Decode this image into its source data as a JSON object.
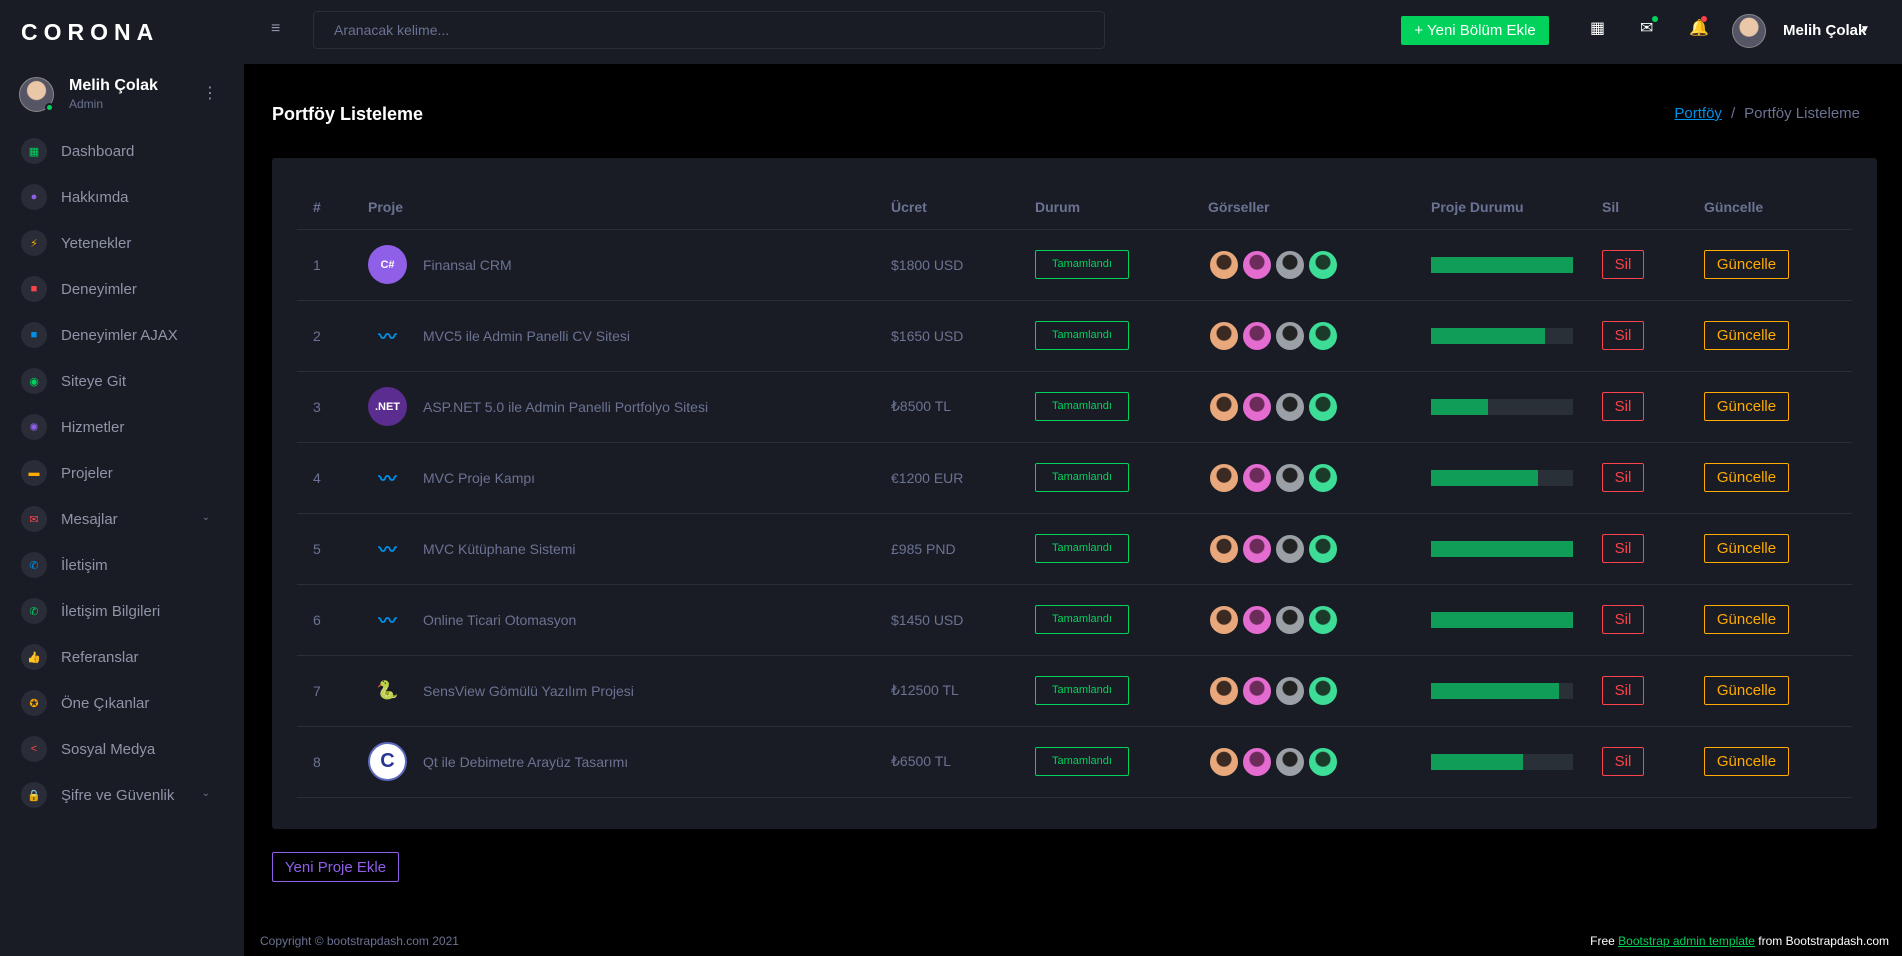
{
  "brand": "CORONA",
  "profile": {
    "name": "Melih Çolak",
    "role": "Admin"
  },
  "sidebar": {
    "items": [
      {
        "label": "Dashboard",
        "icon": "dashboard-icon",
        "color": "#00d25b",
        "glyph": "▦"
      },
      {
        "label": "Hakkımda",
        "icon": "account-icon",
        "color": "#8f5fe8",
        "glyph": "●"
      },
      {
        "label": "Yetenekler",
        "icon": "lightning-icon",
        "color": "#ffab00",
        "glyph": "⚡"
      },
      {
        "label": "Deneyimler",
        "icon": "briefcase-icon",
        "color": "#fc424a",
        "glyph": "■"
      },
      {
        "label": "Deneyimler AJAX",
        "icon": "briefcase-icon",
        "color": "#0090e7",
        "glyph": "■"
      },
      {
        "label": "Siteye Git",
        "icon": "web-icon",
        "color": "#00d25b",
        "glyph": "◉"
      },
      {
        "label": "Hizmetler",
        "icon": "settings-icon",
        "color": "#8f5fe8",
        "glyph": "✺"
      },
      {
        "label": "Projeler",
        "icon": "folder-icon",
        "color": "#ffab00",
        "glyph": "▬"
      },
      {
        "label": "Mesajlar",
        "icon": "email-icon",
        "color": "#fc424a",
        "glyph": "✉",
        "expand": "⌄"
      },
      {
        "label": "İletişim",
        "icon": "phone-icon",
        "color": "#0090e7",
        "glyph": "✆"
      },
      {
        "label": "İletişim Bilgileri",
        "icon": "phone-icon",
        "color": "#00d25b",
        "glyph": "✆"
      },
      {
        "label": "Referanslar",
        "icon": "thumb-up-icon",
        "color": "#8f5fe8",
        "glyph": "👍"
      },
      {
        "label": "Öne Çıkanlar",
        "icon": "star-icon",
        "color": "#ffab00",
        "glyph": "✪"
      },
      {
        "label": "Sosyal Medya",
        "icon": "share-icon",
        "color": "#fc424a",
        "glyph": "<"
      },
      {
        "label": "Şifre ve Güvenlik",
        "icon": "lock-icon",
        "color": "#0090e7",
        "glyph": "🔒",
        "expand": "⌄"
      }
    ]
  },
  "topbar": {
    "search_placeholder": "Aranacak kelime...",
    "add_section_label": "+ Yeni Bölüm Ekle",
    "user_name": "Melih Çolak"
  },
  "page": {
    "title": "Portföy Listeleme",
    "breadcrumb": {
      "link": "Portföy",
      "current": "Portföy Listeleme"
    }
  },
  "table": {
    "headers": [
      "#",
      "Proje",
      "Ücret",
      "Durum",
      "Görseller",
      "Proje Durumu",
      "Sil",
      "Güncelle"
    ],
    "rows": [
      {
        "num": "1",
        "project": "Finansal CRM",
        "fee": "$1800 USD",
        "status": "Tamamlandı",
        "progress": 100,
        "logo": "csharp-logo-icon",
        "logo_text": "C#",
        "logo_bg": "#8f5fe8"
      },
      {
        "num": "2",
        "project": "MVC5 ile Admin Panelli CV Sitesi",
        "fee": "$1650 USD",
        "status": "Tamamlandı",
        "progress": 80,
        "logo": "mvc-logo-icon",
        "logo_text": "〰",
        "logo_bg": "transparent"
      },
      {
        "num": "3",
        "project": "ASP.NET 5.0 ile Admin Panelli Portfolyo Sitesi",
        "fee": "₺8500 TL",
        "status": "Tamamlandı",
        "progress": 40,
        "logo": "dotnet-core-logo-icon",
        "logo_text": ".NET",
        "logo_bg": "#5c2d91"
      },
      {
        "num": "4",
        "project": "MVC Proje Kampı",
        "fee": "€1200 EUR",
        "status": "Tamamlandı",
        "progress": 75,
        "logo": "mvc-logo-icon",
        "logo_text": "〰",
        "logo_bg": "transparent"
      },
      {
        "num": "5",
        "project": "MVC Kütüphane Sistemi",
        "fee": "£985 PND",
        "status": "Tamamlandı",
        "progress": 100,
        "logo": "mvc-logo-icon",
        "logo_text": "〰",
        "logo_bg": "transparent"
      },
      {
        "num": "6",
        "project": "Online Ticari Otomasyon",
        "fee": "$1450 USD",
        "status": "Tamamlandı",
        "progress": 100,
        "logo": "mvc-logo-icon",
        "logo_text": "〰",
        "logo_bg": "transparent"
      },
      {
        "num": "7",
        "project": "SensView Gömülü Yazılım Projesi",
        "fee": "₺12500 TL",
        "status": "Tamamlandı",
        "progress": 90,
        "logo": "python-logo-icon",
        "logo_text": "🐍",
        "logo_bg": "transparent"
      },
      {
        "num": "8",
        "project": "Qt ile Debimetre Arayüz Tasarımı",
        "fee": "₺6500 TL",
        "status": "Tamamlandı",
        "progress": 65,
        "logo": "c-language-logo-icon",
        "logo_text": "C",
        "logo_bg": "#ffffff"
      }
    ],
    "delete_label": "Sil",
    "update_label": "Güncelle"
  },
  "buttons": {
    "new_project": "Yeni Proje Ekle"
  },
  "footer": {
    "copyright": "Copyright © bootstrapdash.com 2021",
    "free": "Free",
    "link": "Bootstrap admin template",
    "from": "from Bootstrapdash.com"
  },
  "colors": {
    "success": "#00d25b",
    "danger": "#fc424a",
    "warning": "#ffab00",
    "primary": "#8f5fe8",
    "info": "#0090e7"
  }
}
